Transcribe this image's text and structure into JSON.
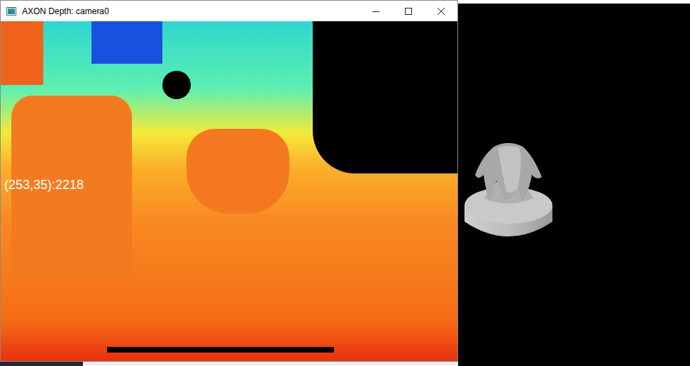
{
  "window": {
    "title": "AXON Depth: camera0"
  },
  "overlay": {
    "text": "(253,35):2218"
  }
}
